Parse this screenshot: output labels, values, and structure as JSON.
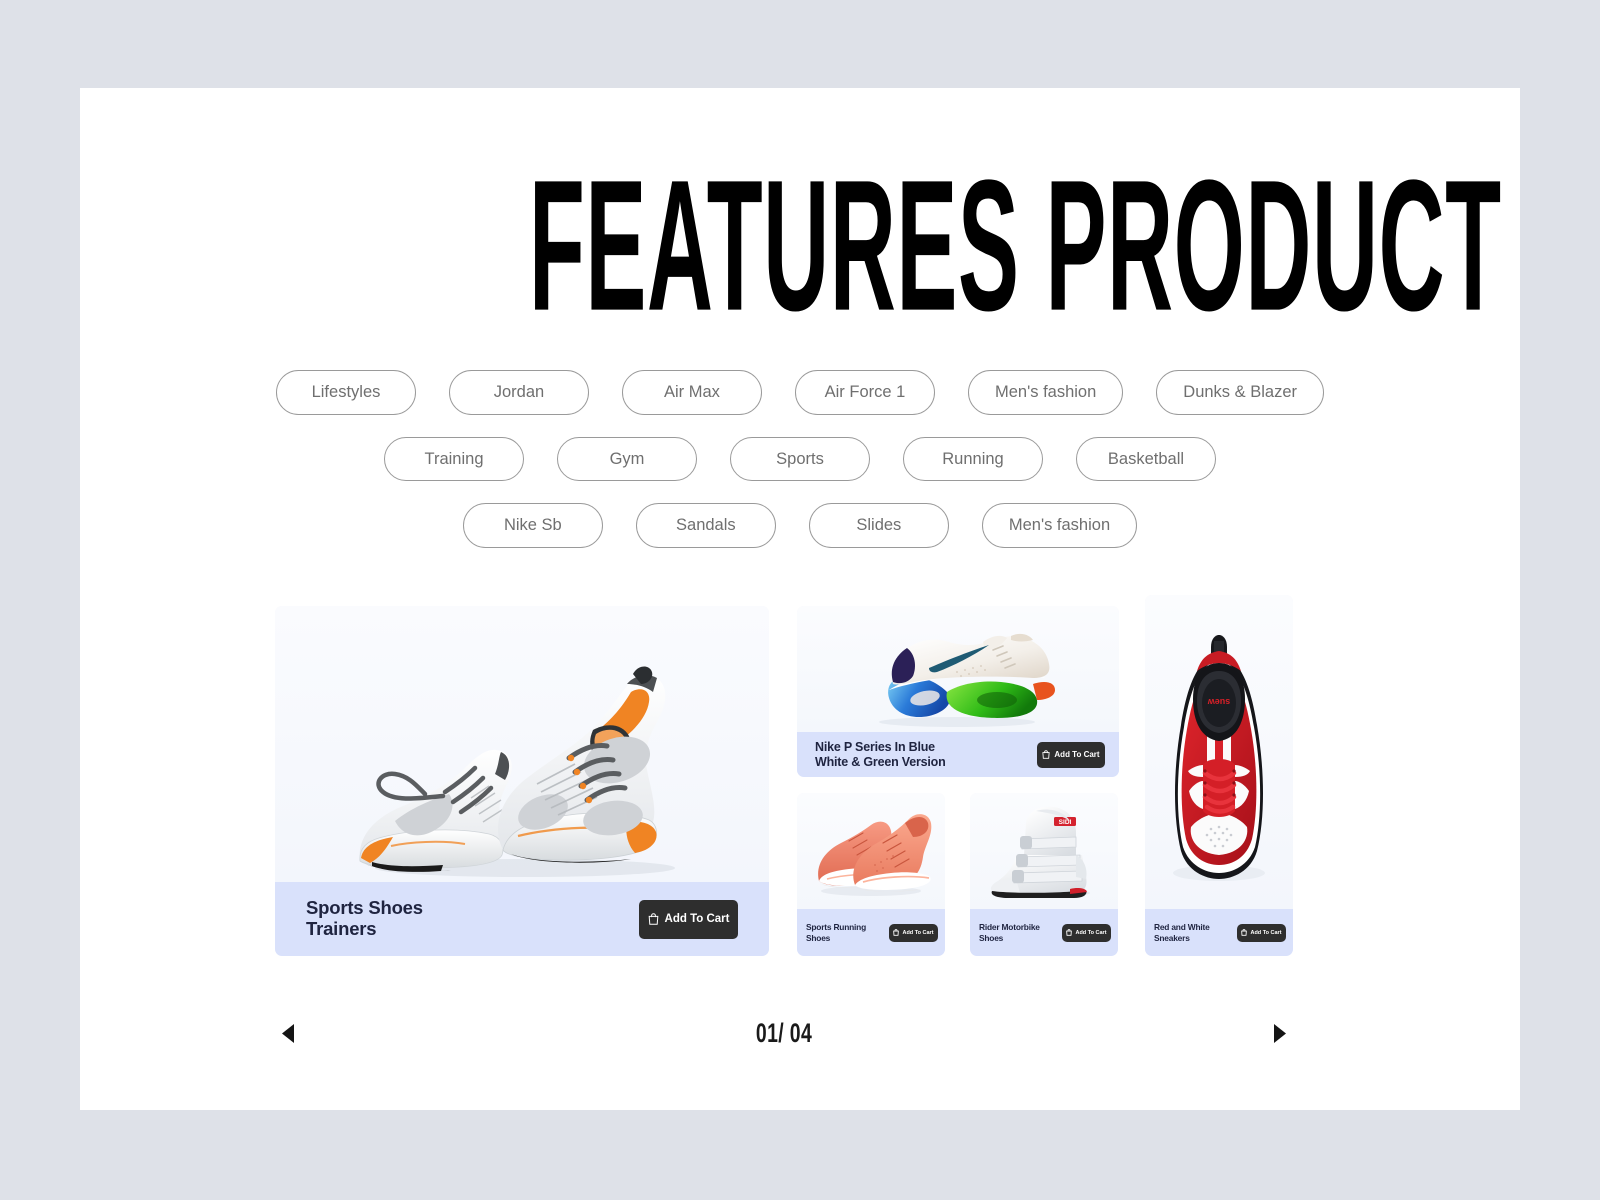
{
  "page": {
    "title": "FEATURES PRODUCT",
    "background_color": "#dee1e8",
    "panel_color": "#ffffff"
  },
  "filters": {
    "rows": [
      [
        {
          "label": "Lifestyles"
        },
        {
          "label": "Jordan"
        },
        {
          "label": "Air Max"
        },
        {
          "label": "Air Force 1"
        },
        {
          "label": "Men's fashion"
        },
        {
          "label": "Dunks & Blazer"
        }
      ],
      [
        {
          "label": "Training"
        },
        {
          "label": "Gym"
        },
        {
          "label": "Sports"
        },
        {
          "label": "Running"
        },
        {
          "label": "Basketball"
        }
      ],
      [
        {
          "label": "Nike Sb"
        },
        {
          "label": "Sandals"
        },
        {
          "label": "Slides"
        },
        {
          "label": "Men's fashion"
        }
      ]
    ]
  },
  "products": {
    "hero": {
      "title_line1": "Sports Shoes",
      "title_line2": "Trainers",
      "cart_label": "Add To Cart",
      "image_alt": "white-gray-orange-running-shoes-pair"
    },
    "nike": {
      "title_line1": "Nike P Series In Blue",
      "title_line2": "White & Green Version",
      "cart_label": "Add To Cart",
      "image_alt": "white-nike-shoe-blue-green-gradient-sole"
    },
    "small": [
      {
        "title_line1": "Sports Running",
        "title_line2": "Shoes",
        "cart_label": "Add To Cart",
        "image_alt": "coral-salmon-running-shoes-pair"
      },
      {
        "title_line1": "Rider Motorbike",
        "title_line2": "Shoes",
        "cart_label": "Add To Cart",
        "image_alt": "white-motorbike-riding-boot"
      }
    ],
    "tall": {
      "title_line1": "Red and White",
      "title_line2": "Sneakers",
      "cart_label": "Add To Cart",
      "image_alt": "red-white-sneaker-top-view"
    }
  },
  "pagination": {
    "count": "01/ 04",
    "prev_icon": "chevron-left-icon",
    "next_icon": "chevron-right-icon"
  },
  "colors": {
    "caption_bar": "#d9e1fb",
    "image_bg": "#f6f8fc",
    "cart_button": "#2e2e2e",
    "pill_border": "#9a9a9a",
    "pill_text": "#6f6f6f",
    "caption_text": "#1f2440"
  }
}
